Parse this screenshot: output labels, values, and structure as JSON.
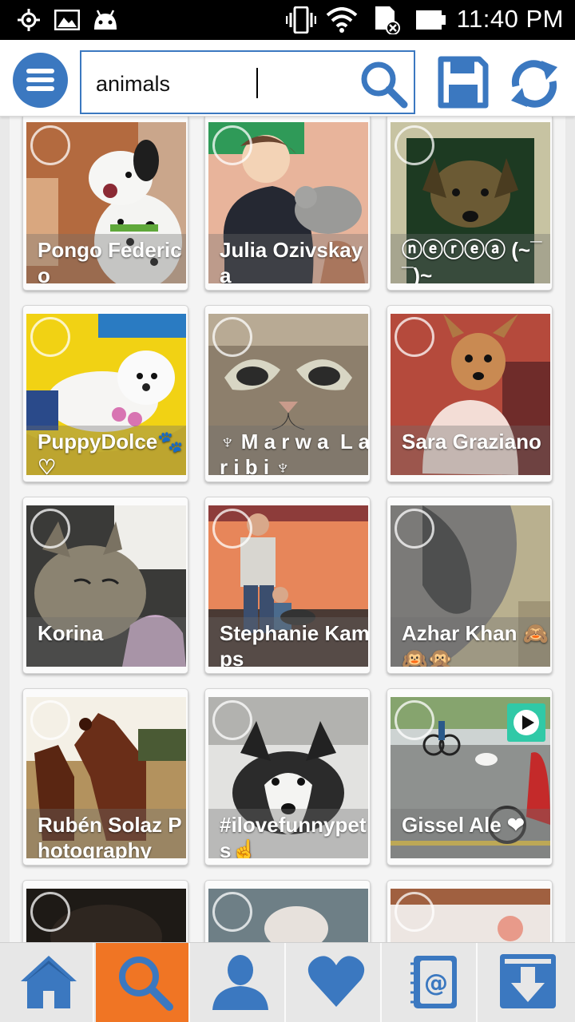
{
  "status_bar": {
    "time": "11:40 PM",
    "icons": [
      "gps-icon",
      "image-icon",
      "android-icon",
      "vibrate-icon",
      "wifi-icon",
      "sd-card-icon",
      "battery-icon"
    ]
  },
  "app_bar": {
    "menu_icon": "hamburger-menu-icon",
    "search": {
      "value": "animals",
      "placeholder": ""
    },
    "save_icon": "floppy-disk-icon",
    "refresh_icon": "refresh-icon"
  },
  "colors": {
    "accent_blue": "#3b78c0",
    "active_tab": "#f07524",
    "video_badge": "#30c9a7"
  },
  "results": [
    {
      "caption": "Pongo Federico",
      "photo": "dalmatian-photo"
    },
    {
      "caption": "Julia Ozivskaya",
      "photo": "girl-and-cat-photo"
    },
    {
      "caption": "ⓝⓔⓡⓔⓐ (~¯¯)~",
      "photo": "dog-photo"
    },
    {
      "caption": "PuppyDolce🐾 ♡",
      "photo": "maltese-photo"
    },
    {
      "caption": "♆ M a r w a  L a r i b i ♆",
      "photo": "cat-closeup-photo"
    },
    {
      "caption": "Sara Graziano",
      "photo": "chihuahua-photo"
    },
    {
      "caption": "Korina",
      "photo": "tabby-cat-photo"
    },
    {
      "caption": "Stephanie Kamps",
      "photo": "man-and-child-photo"
    },
    {
      "caption": "Azhar Khan 🙈🙉🙊",
      "photo": "elephant-photo"
    },
    {
      "caption": "Rubén Solaz Photography",
      "photo": "horses-photo"
    },
    {
      "caption": "#ilovefunnypets☝",
      "photo": "husky-photo"
    },
    {
      "caption": "Gissel Ale ❤",
      "photo": "street-dog-photo",
      "video": true
    },
    {
      "caption": "",
      "photo": "dark-dog-photo"
    },
    {
      "caption": "",
      "photo": "blurry-cat-photo"
    },
    {
      "caption": "",
      "photo": "drawing-photo"
    }
  ],
  "bottom_nav": [
    {
      "name": "home",
      "icon": "home-icon",
      "active": false
    },
    {
      "name": "search",
      "icon": "search-icon",
      "active": true
    },
    {
      "name": "profile",
      "icon": "user-icon",
      "active": false
    },
    {
      "name": "likes",
      "icon": "heart-icon",
      "active": false
    },
    {
      "name": "contacts",
      "icon": "address-book-icon",
      "active": false
    },
    {
      "name": "downloads",
      "icon": "download-icon",
      "active": false
    }
  ]
}
